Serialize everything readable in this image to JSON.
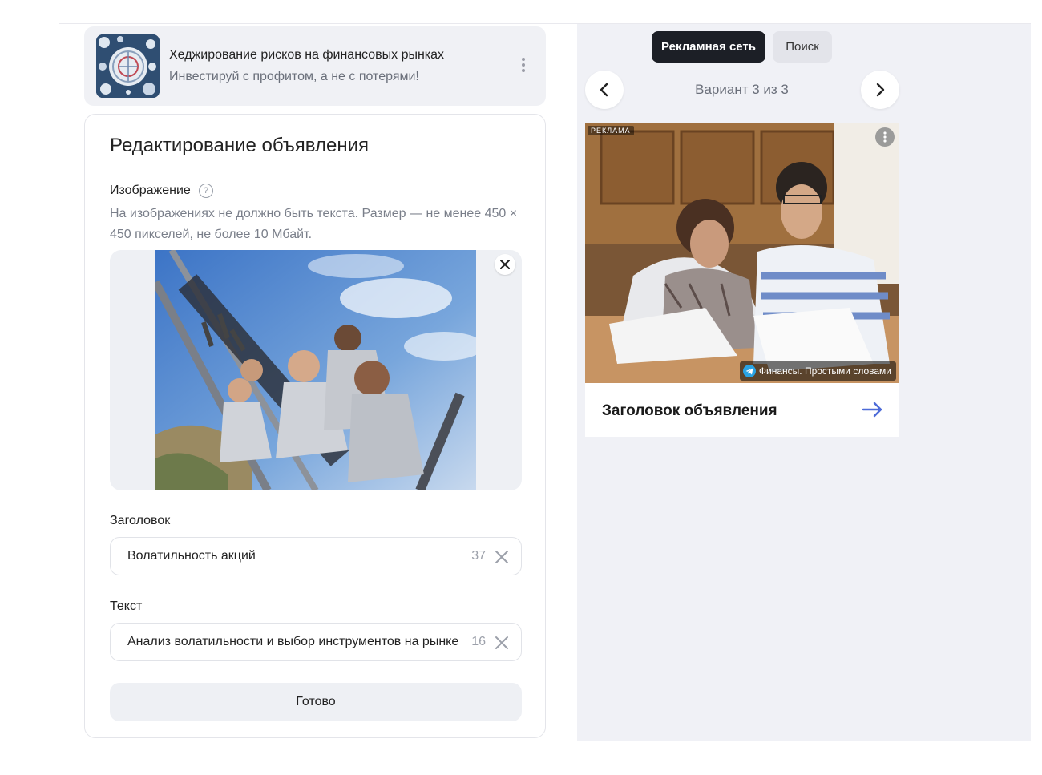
{
  "campaign": {
    "title": "Хеджирование рисков на финансовых рынках",
    "subtitle": "Инвестируй с профитом, а не с потерями!"
  },
  "editor": {
    "title": "Редактирование объявления",
    "image_label": "Изображение",
    "help_glyph": "?",
    "image_hint": "На изображениях не должно быть текста. Размер — не менее 450 × 450 пикселей, не более 10 Мбайт.",
    "headline_label": "Заголовок",
    "headline_value": "Волатильность акций",
    "headline_counter": "37",
    "text_label": "Текст",
    "text_value": "Анализ волатильности и выбор инструментов на рынке",
    "text_counter": "16",
    "done_label": "Готово"
  },
  "preview": {
    "tabs": [
      "Рекламная сеть",
      "Поиск"
    ],
    "active_tab": "Рекламная сеть",
    "variant_label": "Вариант 3 из 3",
    "ad_badge": "РЕКЛАМА",
    "ad_source": "Финансы. Простыми словами",
    "ad_headline": "Заголовок объявления"
  },
  "colors": {
    "accent": "#4d6bd8",
    "tab_active_bg": "#1c1f26",
    "panel_bg": "#f0f1f6",
    "telegram": "#2aa3e3"
  }
}
